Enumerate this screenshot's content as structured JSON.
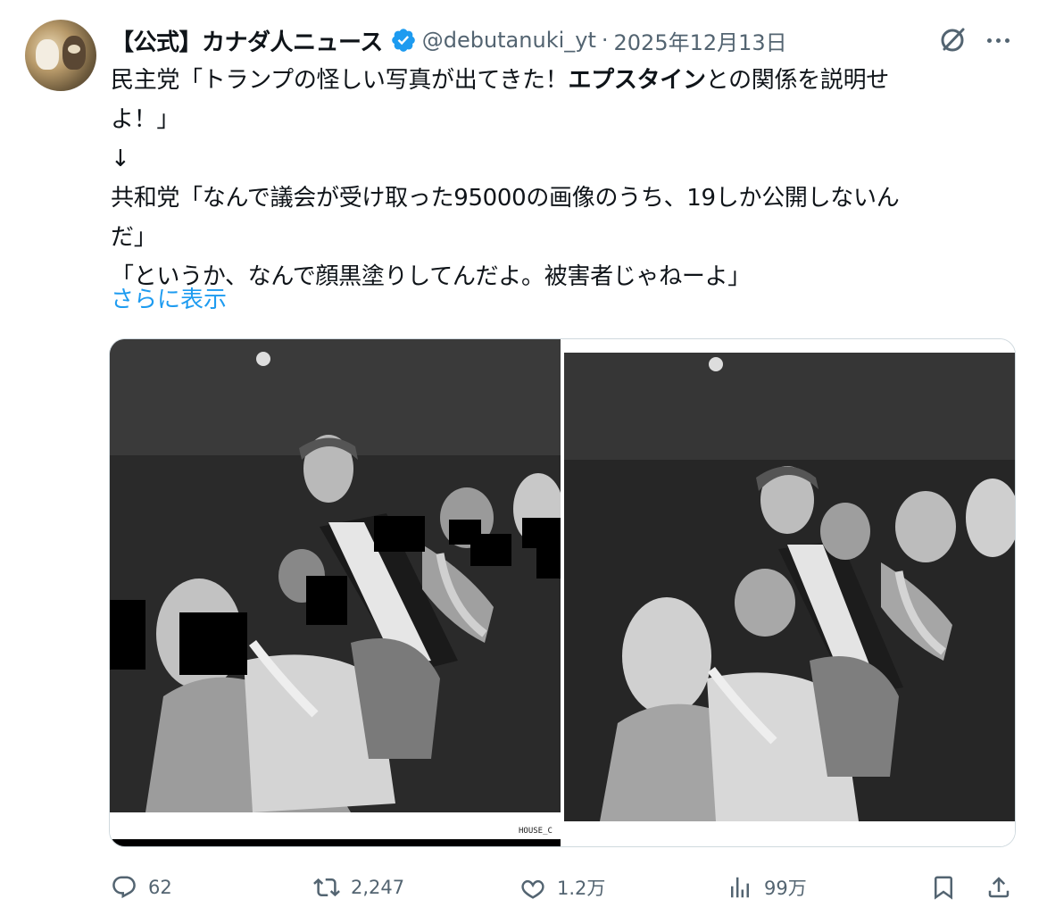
{
  "tweet": {
    "display_name": "【公式】カナダ人ニュース",
    "handle": "@debutanuki_yt",
    "separator": "·",
    "date": "2025年12月13日",
    "text_lines": [
      {
        "before": "民主党「トランプの怪しい写真が出てきた！",
        "bold": "エプスタイン",
        "after": "との関係を説明せ"
      },
      {
        "before": "よ！」",
        "bold": "",
        "after": ""
      },
      {
        "before": "↓",
        "bold": "",
        "after": ""
      },
      {
        "before": "共和党「なんで議会が受け取った95000の画像のうち、19しか公開しないん",
        "bold": "",
        "after": ""
      },
      {
        "before": "だ」",
        "bold": "",
        "after": ""
      },
      {
        "before": "「というか、なんで顔黒塗りしてんだよ。被害者じゃねーよ」",
        "bold": "",
        "after": ""
      }
    ],
    "show_more": "さらに表示",
    "media_caption_left": "HOUSE_C"
  },
  "icons": {
    "avatar": "avatar-cats",
    "verified": "verified-badge-icon",
    "grok": "grok-icon",
    "more": "more-icon",
    "reply": "reply-icon",
    "repost": "repost-icon",
    "like": "like-icon",
    "views": "views-icon",
    "bookmark": "bookmark-icon",
    "share": "share-icon"
  },
  "actions": {
    "reply_count": "62",
    "repost_count": "2,247",
    "like_count": "1.2万",
    "view_count": "99万"
  },
  "colors": {
    "accent": "#1d9bf0",
    "secondary_text": "#536471",
    "primary_text": "#0f1419"
  }
}
